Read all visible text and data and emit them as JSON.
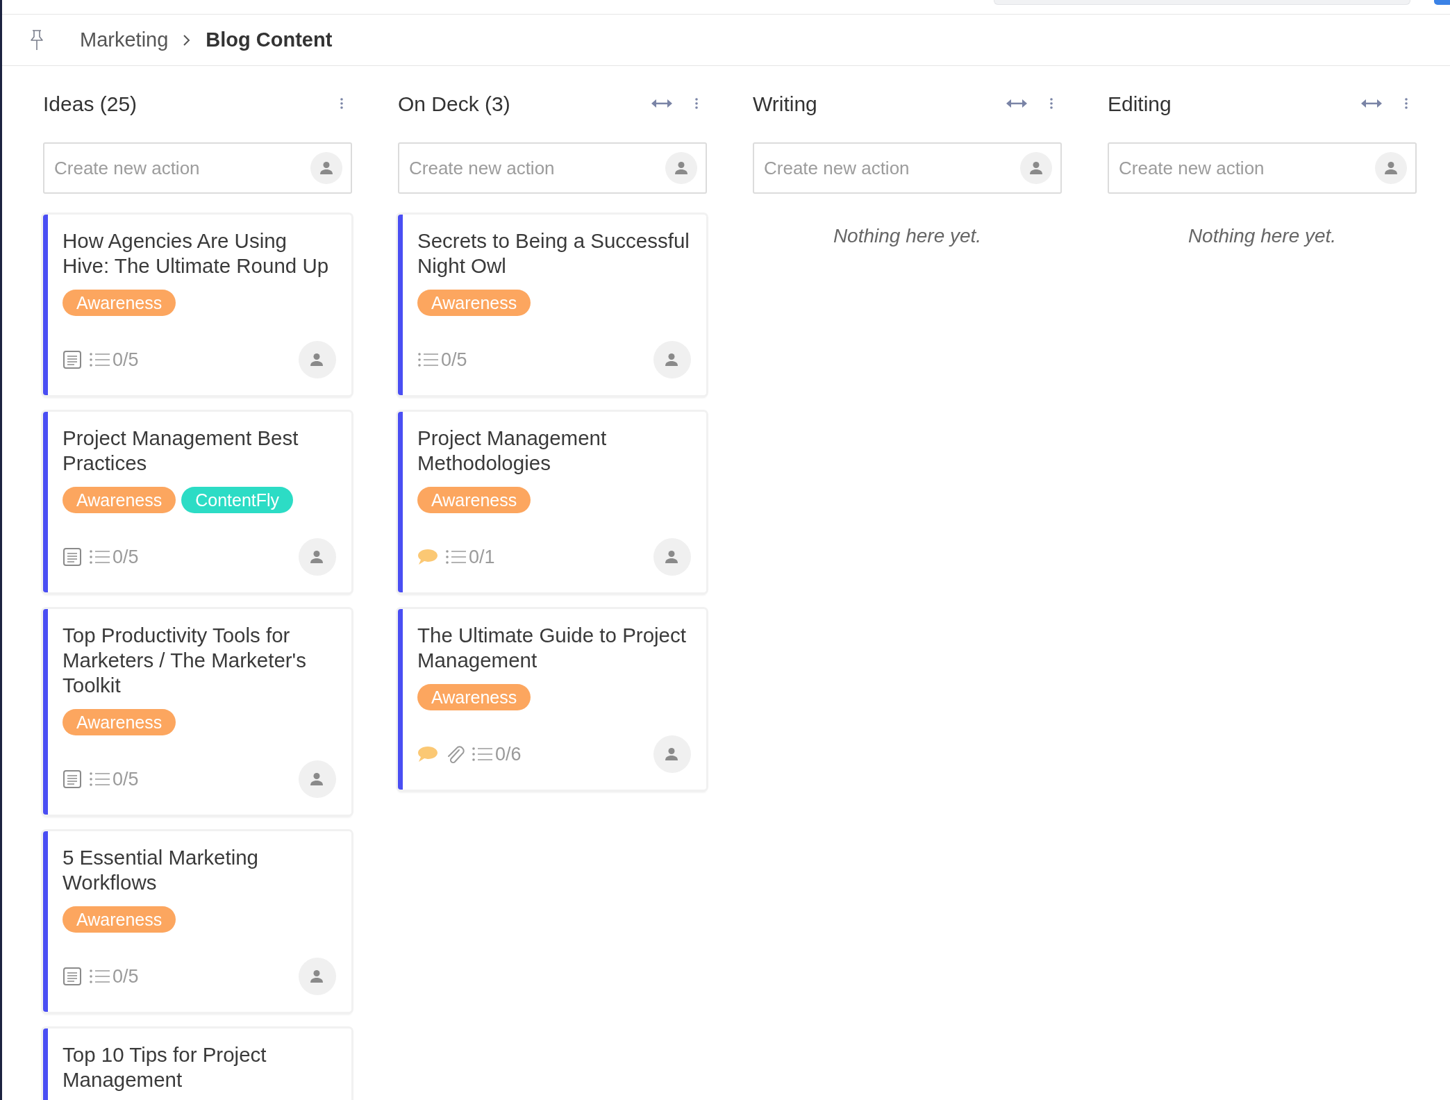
{
  "breadcrumb": {
    "items": [
      {
        "label": "Marketing",
        "current": false
      },
      {
        "label": "Blog Content",
        "current": true
      }
    ]
  },
  "columns": [
    {
      "title": "Ideas (25)",
      "controls": [
        {
          "kind": "menu"
        }
      ],
      "input": {
        "placeholder": "Create new action"
      },
      "cards": [
        {
          "title": "How Agencies Are Using Hive: The Ultimate Round Up",
          "tags": [
            {
              "label": "Awareness",
              "color": "#fca65f"
            }
          ],
          "indicators": [
            {
              "kind": "note"
            }
          ],
          "checklist": "0/5"
        },
        {
          "title": "Project Management Best Practices",
          "tags": [
            {
              "label": "Awareness",
              "color": "#fca65f"
            },
            {
              "label": "ContentFly",
              "color": "#2cdcc5"
            }
          ],
          "indicators": [
            {
              "kind": "note"
            }
          ],
          "checklist": "0/5"
        },
        {
          "title": "Top Productivity Tools for Marketers / The Marketer's Toolkit",
          "tags": [
            {
              "label": "Awareness",
              "color": "#fca65f"
            }
          ],
          "indicators": [
            {
              "kind": "note"
            }
          ],
          "checklist": "0/5"
        },
        {
          "title": "5 Essential Marketing Workflows",
          "tags": [
            {
              "label": "Awareness",
              "color": "#fca65f"
            }
          ],
          "indicators": [
            {
              "kind": "note"
            }
          ],
          "checklist": "0/5"
        },
        {
          "title": "Top 10 Tips for Project Management"
        }
      ]
    },
    {
      "title": "On Deck (3)",
      "controls": [
        {
          "kind": "expand"
        },
        {
          "kind": "menu"
        }
      ],
      "input": {
        "placeholder": "Create new action"
      },
      "cards": [
        {
          "title": "Secrets to Being a Successful Night Owl",
          "tags": [
            {
              "label": "Awareness",
              "color": "#fca65f"
            }
          ],
          "checklist": "0/5"
        },
        {
          "title": "Project Management Methodologies",
          "tags": [
            {
              "label": "Awareness",
              "color": "#fca65f"
            }
          ],
          "indicators": [
            {
              "kind": "comment"
            }
          ],
          "checklist": "0/1"
        },
        {
          "title": "The Ultimate Guide to Project Management",
          "tags": [
            {
              "label": "Awareness",
              "color": "#fca65f"
            }
          ],
          "indicators": [
            {
              "kind": "comment"
            },
            {
              "kind": "attachment"
            }
          ],
          "checklist": "0/6"
        }
      ]
    },
    {
      "title": "Writing",
      "controls": [
        {
          "kind": "expand"
        },
        {
          "kind": "menu"
        }
      ],
      "input": {
        "placeholder": "Create new action"
      },
      "empty_text": "Nothing here yet."
    },
    {
      "title": "Editing",
      "controls": [
        {
          "kind": "expand"
        },
        {
          "kind": "menu"
        }
      ],
      "input": {
        "placeholder": "Create new action"
      },
      "empty_text": "Nothing here yet."
    }
  ]
}
